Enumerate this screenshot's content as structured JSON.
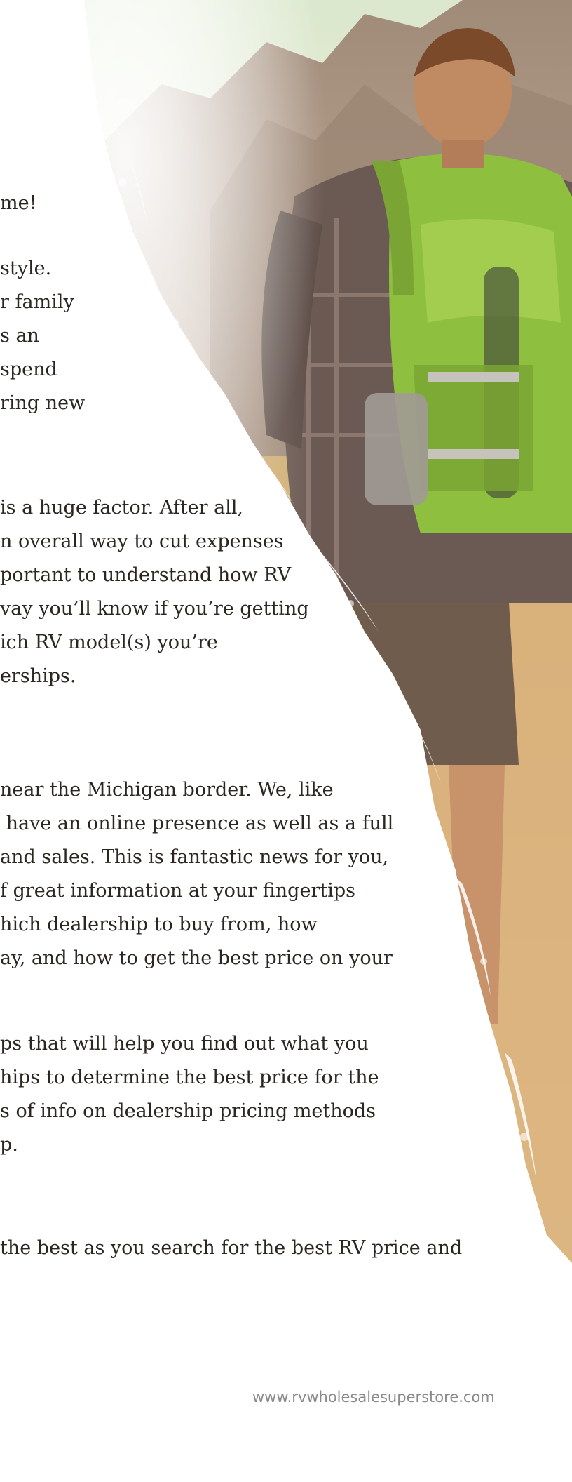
{
  "document": {
    "intro_lines": [
      "me!"
    ],
    "paragraph_1": [
      "style.",
      "r family",
      "s an",
      "spend",
      "ring new"
    ],
    "paragraph_2": [
      "is a huge factor. After all,",
      "n overall way to cut expenses",
      "portant to understand how RV",
      "vay you’ll know if you’re getting",
      "ich RV model(s) you’re",
      "erships."
    ],
    "paragraph_3": [
      "near the Michigan border. We, like",
      " have an online presence as well as a full",
      "and sales. This is fantastic news for you,",
      "f great information at your fingertips",
      "hich dealership to buy from, how",
      "ay, and how to get the best price on your"
    ],
    "paragraph_4": [
      "ps that will help you find out what you",
      "hips to determine the best price for the",
      "s of info on dealership pricing methods",
      "p."
    ],
    "closing_line": "the best as you search for the best RV price and",
    "footer_url": "www.rvwholesalesuperstore.com"
  },
  "image": {
    "subject": "hiker-with-green-backpack",
    "palette": {
      "sky": "#d8e6c8",
      "mountain": "#8d7a68",
      "backpack": "#8fbf3f",
      "shirt": "#6b5a53",
      "grass": "#c99a5e"
    }
  }
}
